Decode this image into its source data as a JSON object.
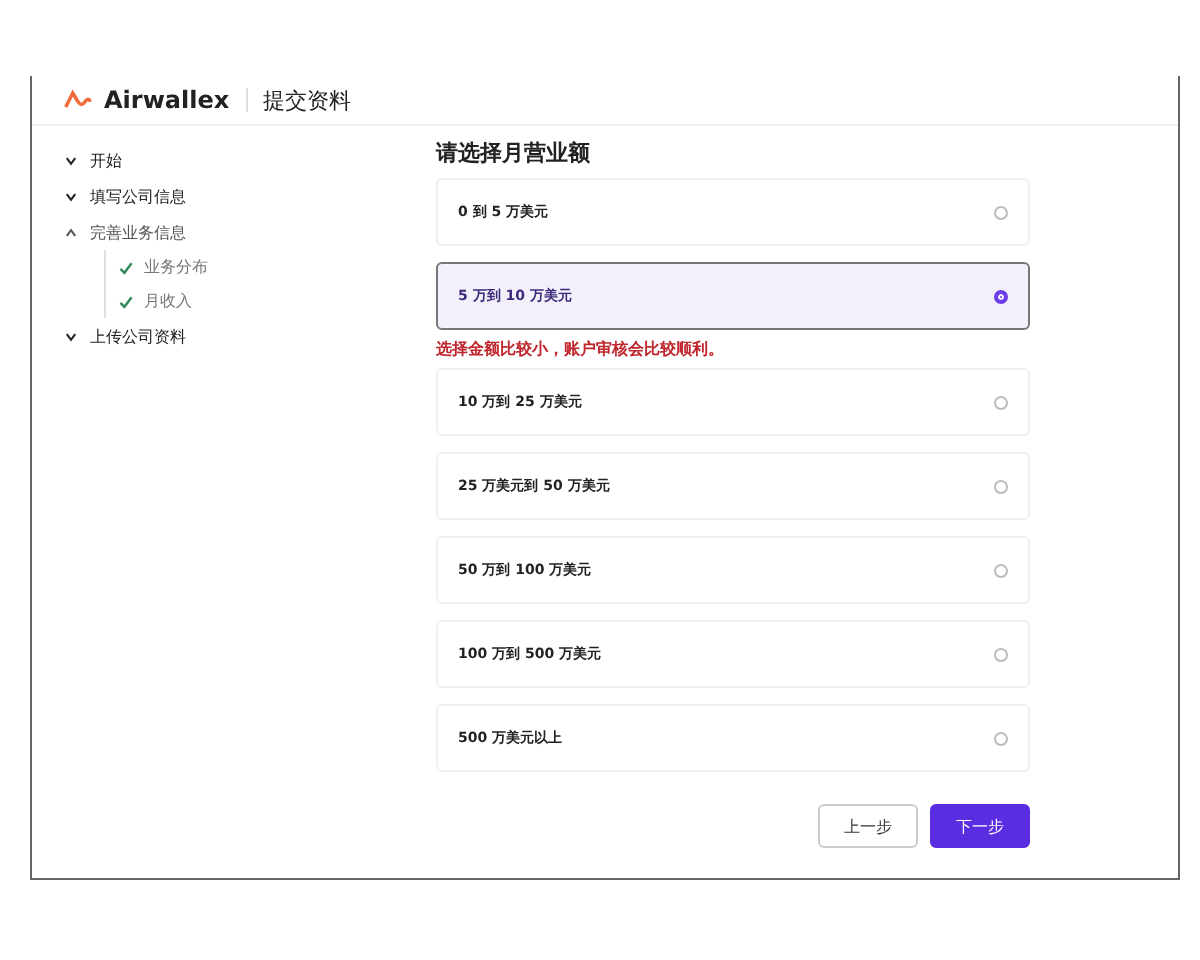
{
  "header": {
    "brand": "Airwallex",
    "title": "提交资料"
  },
  "sidebar": {
    "items": [
      {
        "label": "开始",
        "expanded": false
      },
      {
        "label": "填写公司信息",
        "expanded": false
      },
      {
        "label": "完善业务信息",
        "expanded": true,
        "children": [
          {
            "label": "业务分布",
            "checked": true
          },
          {
            "label": "月收入",
            "checked": true
          }
        ]
      },
      {
        "label": "上传公司资料",
        "expanded": false
      }
    ]
  },
  "form": {
    "heading": "请选择月营业额",
    "options": [
      {
        "label": "0 到 5 万美元",
        "selected": false
      },
      {
        "label": "5 万到 10 万美元",
        "selected": true,
        "note": "选择金额比较小，账户审核会比较顺利。"
      },
      {
        "label": "10 万到 25 万美元",
        "selected": false
      },
      {
        "label": "25 万美元到 50 万美元",
        "selected": false
      },
      {
        "label": "50 万到 100 万美元",
        "selected": false
      },
      {
        "label": "100 万到 500 万美元",
        "selected": false
      },
      {
        "label": "500 万美元以上",
        "selected": false
      }
    ],
    "buttons": [
      {
        "label": "上一步",
        "kind": "secondary"
      },
      {
        "label": "下一步",
        "kind": "primary"
      }
    ]
  }
}
